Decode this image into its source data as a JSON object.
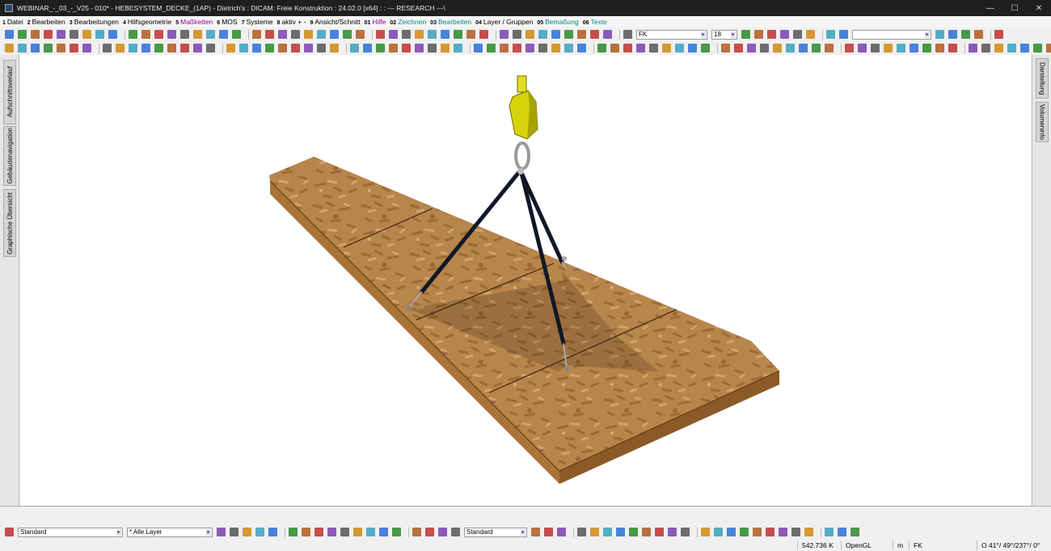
{
  "window": {
    "title": "WEBINAR_-_03_-_V25 - 010* - HEBESYSTEM_DECKE_(1AP) - Dietrich's : DICAM: Freie Konstruktion : 24.02.0 [x64] : : --- RESEARCH ---\\",
    "minimize": "—",
    "maximize": "☐",
    "close": "✕"
  },
  "menu": [
    {
      "num": "1",
      "label": "Datei"
    },
    {
      "num": "2",
      "label": "Bearbeiten"
    },
    {
      "num": "3",
      "label": "Bearbeitungen"
    },
    {
      "num": "4",
      "label": "Hilfsgeometrie"
    },
    {
      "num": "5",
      "label": "Maßketten",
      "color": "purple"
    },
    {
      "num": "6",
      "label": "MOS"
    },
    {
      "num": "7",
      "label": "Systeme"
    },
    {
      "num": "8",
      "label": "aktiv + -"
    },
    {
      "num": "9",
      "label": "Ansicht/Schnitt"
    },
    {
      "num": "01",
      "label": "Hilfe",
      "color": "purple"
    },
    {
      "num": "02",
      "label": "Zeichnen",
      "color": "teal"
    },
    {
      "num": "03",
      "label": "Bearbeiten",
      "color": "teal"
    },
    {
      "num": "04",
      "label": "Layer / Gruppen"
    },
    {
      "num": "05",
      "label": "Bemaßung",
      "color": "teal"
    },
    {
      "num": "06",
      "label": "Texte",
      "color": "teal"
    }
  ],
  "toolbar": {
    "layer_combo": "FK",
    "size_combo": "18",
    "empty_combo": ""
  },
  "left_tabs": [
    "Aufschnittsverlauf",
    "Gebäudenavigation",
    "Graphische Übersicht"
  ],
  "right_tabs": [
    "Darstellung",
    "Volumeninfo"
  ],
  "bottom_toolbar": {
    "style_combo": "Standard",
    "layer_combo": "* Alle Layer",
    "line_combo": "Standard"
  },
  "status": {
    "measure": "542.736 K",
    "renderer": "OpenGL",
    "unit": "m",
    "layer": "FK",
    "angles": "O 41°/ 49°/237°/ 0°"
  },
  "colors": {
    "osb_dark": "#8a5a2b",
    "osb_light": "#c9995e",
    "sling": "#101828",
    "hook": "#d8d20a"
  }
}
